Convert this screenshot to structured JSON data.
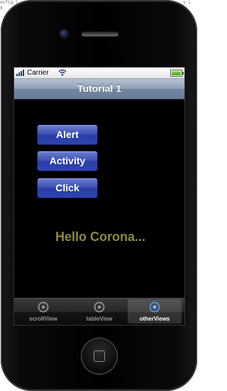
{
  "background_text": {
    "left_line1": "onfig.l",
    "left_line2": "d",
    "right_line1": "v i",
    "right_line2": "i"
  },
  "status_bar": {
    "carrier": "Carrier",
    "signal_icon": "signal-bars-icon",
    "wifi_icon": "wifi-icon",
    "battery_icon": "battery-icon",
    "battery_level": 1.0
  },
  "nav_bar": {
    "title": "Tutorial 1"
  },
  "buttons": {
    "alert": "Alert",
    "activity": "Activity",
    "click": "Click"
  },
  "content": {
    "hello_text": "Hello Corona..."
  },
  "tab_bar": {
    "tabs": [
      {
        "label": "scrollView",
        "icon": "circle-icon",
        "selected": false
      },
      {
        "label": "tableView",
        "icon": "circle-icon",
        "selected": false
      },
      {
        "label": "otherViews",
        "icon": "circle-icon",
        "selected": true
      }
    ]
  },
  "colors": {
    "button_blue": "#2e44ae",
    "hello_text": "#8a8c3a",
    "nav_bar": "#8e9fb6",
    "selected_tab_icon": "#4a90e2"
  }
}
